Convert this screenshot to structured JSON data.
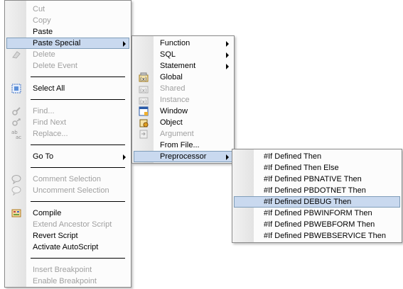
{
  "main_menu": {
    "cut": "Cut",
    "copy": "Copy",
    "paste": "Paste",
    "paste_special": "Paste Special",
    "delete": "Delete",
    "delete_event": "Delete Event",
    "select_all": "Select All",
    "find": "Find...",
    "find_next": "Find Next",
    "replace": "Replace...",
    "go_to": "Go To",
    "comment_selection": "Comment Selection",
    "uncomment_selection": "Uncomment Selection",
    "compile": "Compile",
    "extend_ancestor_script": "Extend Ancestor Script",
    "revert_script": "Revert Script",
    "activate_autoscript": "Activate AutoScript",
    "insert_breakpoint": "Insert Breakpoint",
    "enable_breakpoint": "Enable Breakpoint"
  },
  "paste_special_menu": {
    "function": "Function",
    "sql": "SQL",
    "statement": "Statement",
    "global": "Global",
    "shared": "Shared",
    "instance": "Instance",
    "window": "Window",
    "object": "Object",
    "argument": "Argument",
    "from_file": "From File...",
    "preprocessor": "Preprocessor"
  },
  "preprocessor_menu": {
    "items": [
      "#If Defined Then",
      "#If Defined Then Else",
      "#If Defined PBNATIVE Then",
      "#If Defined PBDOTNET Then",
      "#If Defined DEBUG Then",
      "#If Defined PBWINFORM Then",
      "#If Defined PBWEBFORM Then",
      "#If Defined PBWEBSERVICE Then"
    ]
  },
  "colors": {
    "highlight_bg": "#c9d9ef",
    "highlight_border": "#7f9db9",
    "disabled_text": "#a0a0a0"
  }
}
